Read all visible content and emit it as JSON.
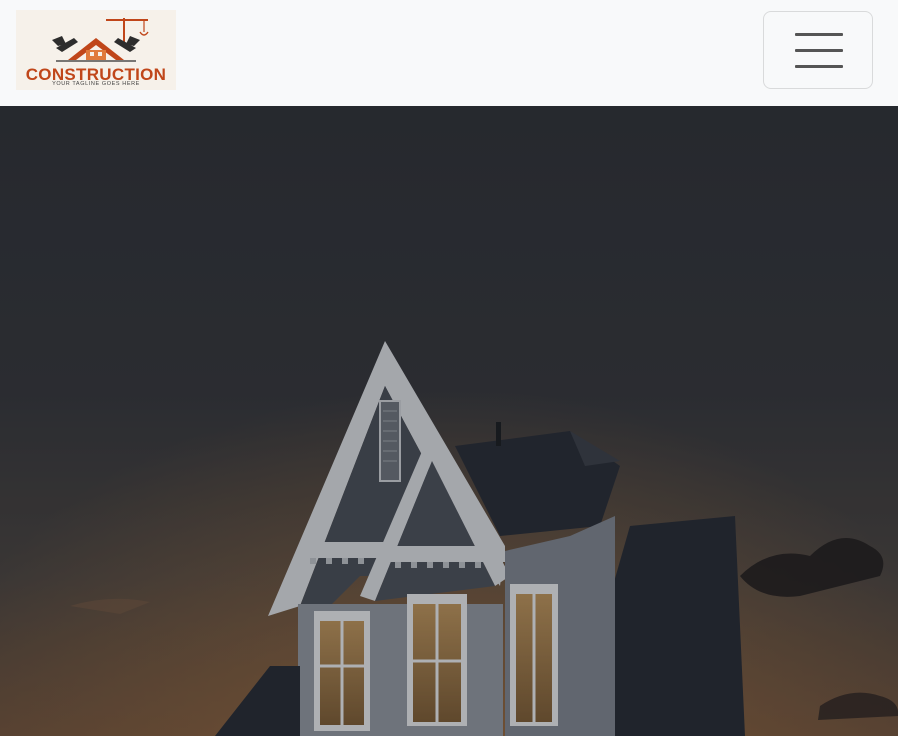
{
  "brand": {
    "logo_word": "CONSTRUCTION",
    "logo_tagline": "YOUR TAGLINE GOES HERE",
    "logo_icon": "house-hammer-logo",
    "accent_color": "#c0461a"
  },
  "navbar": {
    "toggle_icon": "hamburger-menu-icon"
  },
  "hero": {
    "image_subject": "house-at-dusk-image"
  }
}
